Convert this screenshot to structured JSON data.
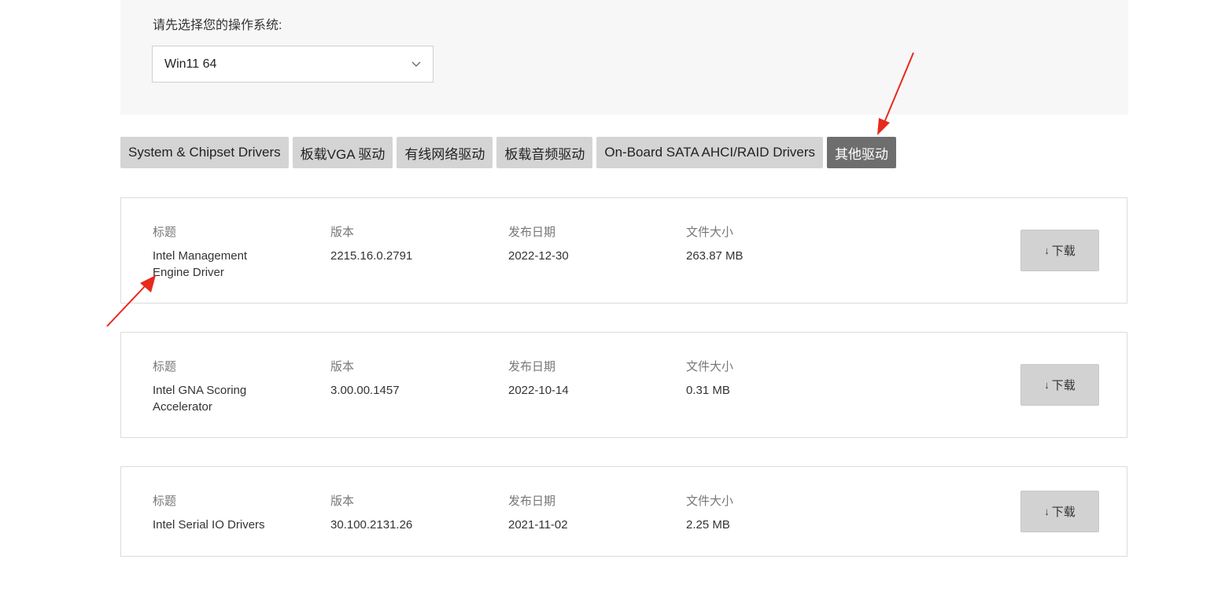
{
  "os_selector": {
    "label": "请先选择您的操作系统:",
    "selected": "Win11 64"
  },
  "tabs": [
    {
      "label": "System & Chipset Drivers",
      "active": false
    },
    {
      "label": "板载VGA 驱动",
      "active": false
    },
    {
      "label": "有线网络驱动",
      "active": false
    },
    {
      "label": "板载音频驱动",
      "active": false
    },
    {
      "label": "On-Board SATA AHCI/RAID Drivers",
      "active": false
    },
    {
      "label": "其他驱动",
      "active": true
    }
  ],
  "columns": {
    "title": "标题",
    "version": "版本",
    "date": "发布日期",
    "size": "文件大小"
  },
  "drivers": [
    {
      "title_line1": "Intel Management",
      "title_line2": "Engine Driver",
      "version": "2215.16.0.2791",
      "date": "2022-12-30",
      "size": "263.87 MB",
      "download_label": "下载"
    },
    {
      "title_line1": "Intel GNA Scoring",
      "title_line2": "Accelerator",
      "version": "3.00.00.1457",
      "date": "2022-10-14",
      "size": "0.31 MB",
      "download_label": "下载"
    },
    {
      "title_line1": "Intel Serial IO Drivers",
      "title_line2": "",
      "version": "30.100.2131.26",
      "date": "2021-11-02",
      "size": "2.25 MB",
      "download_label": "下载"
    }
  ],
  "annotation_color": "#e8291c",
  "active_tab_color": "#6e6e6e",
  "icons": {
    "dropdown": "chevron-down-icon",
    "download": "arrow-down-icon"
  }
}
